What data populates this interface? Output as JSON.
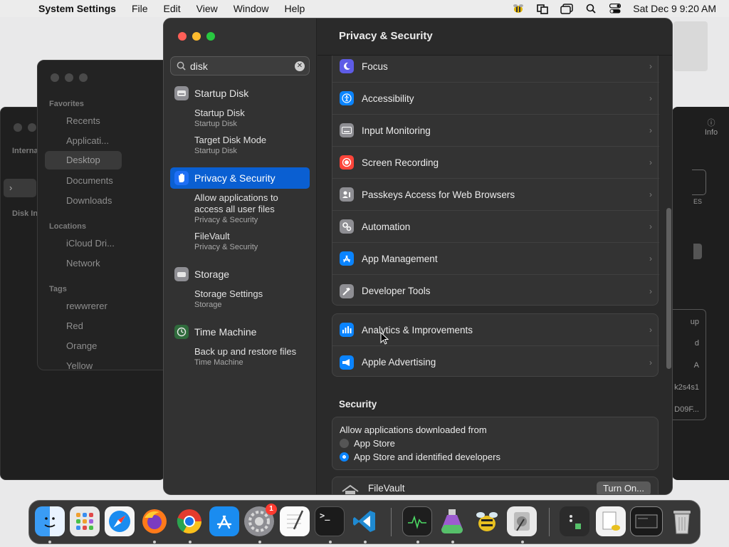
{
  "menubar": {
    "app_name": "System Settings",
    "menus": [
      "File",
      "Edit",
      "View",
      "Window",
      "Help"
    ],
    "clock": "Sat Dec 9  9:20 AM"
  },
  "finder": {
    "favorites_label": "Favorites",
    "favorites": [
      "Recents",
      "Applicati...",
      "Desktop",
      "Documents",
      "Downloads"
    ],
    "locations_label": "Locations",
    "locations": [
      "iCloud Dri...",
      "Network"
    ],
    "tags_label": "Tags",
    "tags": [
      "rewwrerer",
      "Red",
      "Orange",
      "Yellow"
    ]
  },
  "disk_utility": {
    "labels": [
      "Interna",
      "Disk In"
    ],
    "right_fragments": [
      "Info",
      "ES",
      "up",
      "d",
      "A",
      "k2s4s1",
      "D09F..."
    ]
  },
  "search": {
    "value": "disk",
    "placeholder": "Search"
  },
  "results": [
    {
      "title": "Startup Disk",
      "subs": [
        {
          "t": "Startup Disk",
          "s": "Startup Disk"
        },
        {
          "t": "Target Disk Mode",
          "s": "Startup Disk"
        }
      ]
    },
    {
      "title": "Privacy & Security",
      "subs": [
        {
          "t": "Allow applications to access all user files",
          "s": "Privacy & Security"
        },
        {
          "t": "FileVault",
          "s": "Privacy & Security"
        }
      ]
    },
    {
      "title": "Storage",
      "subs": [
        {
          "t": "Storage Settings",
          "s": "Storage"
        }
      ]
    },
    {
      "title": "Time Machine",
      "subs": [
        {
          "t": "Back up and restore files",
          "s": "Time Machine"
        }
      ]
    }
  ],
  "content": {
    "title": "Privacy & Security",
    "privacy_rows": [
      "Focus",
      "Accessibility",
      "Input Monitoring",
      "Screen Recording",
      "Passkeys Access for Web Browsers",
      "Automation",
      "App Management",
      "Developer Tools"
    ],
    "analytics_rows": [
      "Analytics & Improvements",
      "Apple Advertising"
    ],
    "security_title": "Security",
    "allow_label": "Allow applications downloaded from",
    "radio_options": [
      "App Store",
      "App Store and identified developers"
    ],
    "selected_option": 1,
    "filevault_label": "FileVault",
    "filevault_button": "Turn On..."
  },
  "dock": {
    "apps": [
      "Finder",
      "Launchpad",
      "Safari",
      "Firefox",
      "Chrome",
      "App Store",
      "System Settings",
      "TextEdit",
      "Terminal",
      "VS Code",
      "Activity Monitor",
      "Disk Utility Pro",
      "Cyberduck",
      "Disk Utility",
      "Downloads",
      "Documents",
      "Screenshot",
      "Trash"
    ],
    "settings_badge": "1"
  },
  "colors": {
    "accent": "#0a5fd2",
    "close": "#ff5f57",
    "minimize": "#febc2e",
    "zoom": "#28c840"
  }
}
